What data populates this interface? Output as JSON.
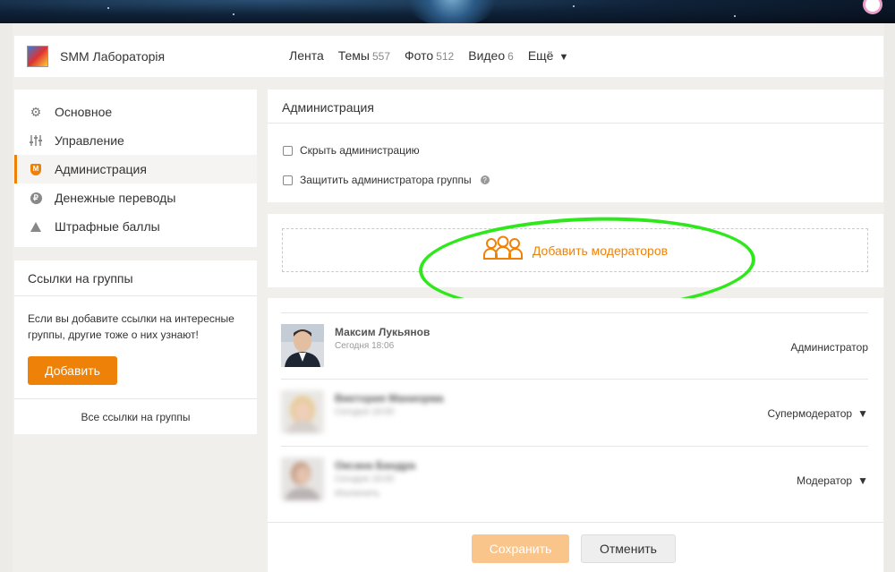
{
  "header": {
    "group_name": "SMM Лабораторія",
    "nav": [
      {
        "label": "Лента",
        "count": ""
      },
      {
        "label": "Темы",
        "count": "557"
      },
      {
        "label": "Фото",
        "count": "512"
      },
      {
        "label": "Видео",
        "count": "6"
      },
      {
        "label": "Ещё",
        "count": ""
      }
    ]
  },
  "sidebar": {
    "items": [
      {
        "label": "Основное",
        "icon": "gear-icon"
      },
      {
        "label": "Управление",
        "icon": "sliders-icon"
      },
      {
        "label": "Администрация",
        "icon": "shield-icon",
        "active": true
      },
      {
        "label": "Денежные переводы",
        "icon": "coin-icon"
      },
      {
        "label": "Штрафные баллы",
        "icon": "warning-icon"
      }
    ]
  },
  "links": {
    "title": "Ссылки на группы",
    "description": "Если вы добавите ссылки на интересные группы, другие тоже о них узнают!",
    "add_label": "Добавить",
    "all_label": "Все ссылки на группы"
  },
  "admin": {
    "title": "Администрация",
    "hide_label": "Скрыть администрацию",
    "protect_label": "Защитить администратора группы"
  },
  "add_moderators": {
    "label": "Добавить модераторов"
  },
  "members": [
    {
      "name": "Максим Лукьянов",
      "time": "Сегодня 18:06",
      "extra": "",
      "role": "Администратор",
      "dropdown": false
    },
    {
      "name": "Виктория Маниорма",
      "time": "Сегодня 19:00",
      "extra": "",
      "role": "Супермодератор",
      "dropdown": true
    },
    {
      "name": "Оксана Бандра",
      "time": "Сегодня 19:00",
      "extra": "Исключить",
      "role": "Модератор",
      "dropdown": true
    }
  ],
  "footer": {
    "save_label": "Сохранить",
    "cancel_label": "Отменить"
  },
  "colors": {
    "accent": "#ee8208",
    "highlight": "#2fe81c"
  }
}
